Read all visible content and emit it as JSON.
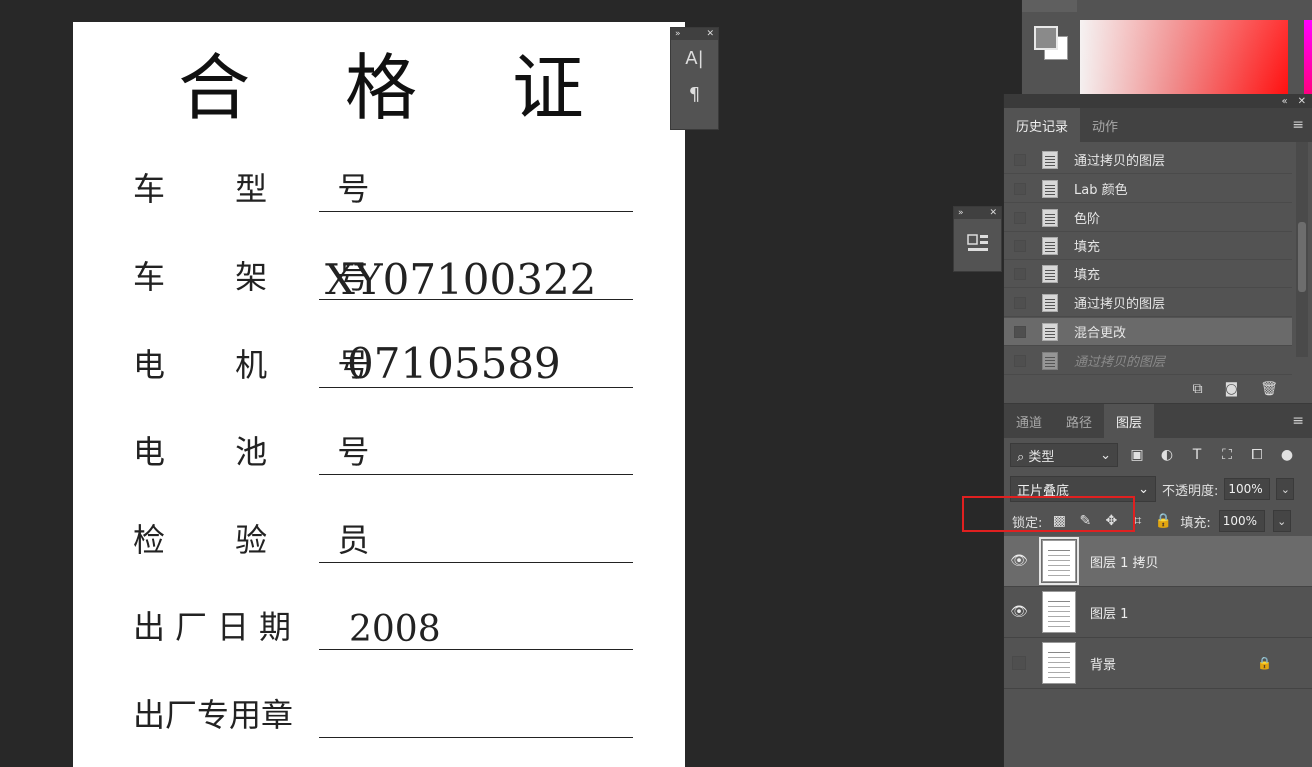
{
  "document": {
    "title": "合 格 证",
    "rows": [
      {
        "label": "车 型 号",
        "value": ""
      },
      {
        "label": "车 架 号",
        "value": "XY07100322"
      },
      {
        "label": "电 机 号",
        "value": "07105589"
      },
      {
        "label": "电 池 号",
        "value": ""
      },
      {
        "label": "检 验 员",
        "value": ""
      },
      {
        "label": "出厂日期",
        "value": "2008"
      },
      {
        "label": "出厂专用章",
        "value": ""
      }
    ]
  },
  "mini_palette": {
    "char_icon": "A|",
    "para_icon": "¶"
  },
  "history_panel": {
    "tabs": [
      "历史记录",
      "动作"
    ],
    "items": [
      {
        "label": "通过拷贝的图层",
        "icon": "history-doc-icon"
      },
      {
        "label": "Lab 颜色",
        "icon": "history-doc-icon"
      },
      {
        "label": "色阶",
        "icon": "history-doc-icon"
      },
      {
        "label": "填充",
        "icon": "history-form-icon"
      },
      {
        "label": "填充",
        "icon": "history-form-icon"
      },
      {
        "label": "通过拷贝的图层",
        "icon": "history-doc-icon"
      },
      {
        "label": "混合更改",
        "icon": "history-doc-icon",
        "selected": true
      },
      {
        "label": "通过拷贝的图层",
        "icon": "history-doc-icon",
        "ghost": true
      }
    ]
  },
  "layers_panel": {
    "tabs": [
      "通道",
      "路径",
      "图层"
    ],
    "kind_filter": "类型",
    "blend_mode": "正片叠底",
    "opacity_label": "不透明度:",
    "opacity_value": "100%",
    "lock_label": "锁定:",
    "fill_label": "填充:",
    "fill_value": "100%",
    "layers": [
      {
        "name": "图层 1 拷贝",
        "visible": true,
        "selected": true
      },
      {
        "name": "图层 1",
        "visible": true
      },
      {
        "name": "背景",
        "visible": false,
        "locked": true
      }
    ]
  },
  "colors": {
    "accent_highlight": "#e02020",
    "panel_bg": "#535353",
    "canvas_bg": "#282828"
  }
}
